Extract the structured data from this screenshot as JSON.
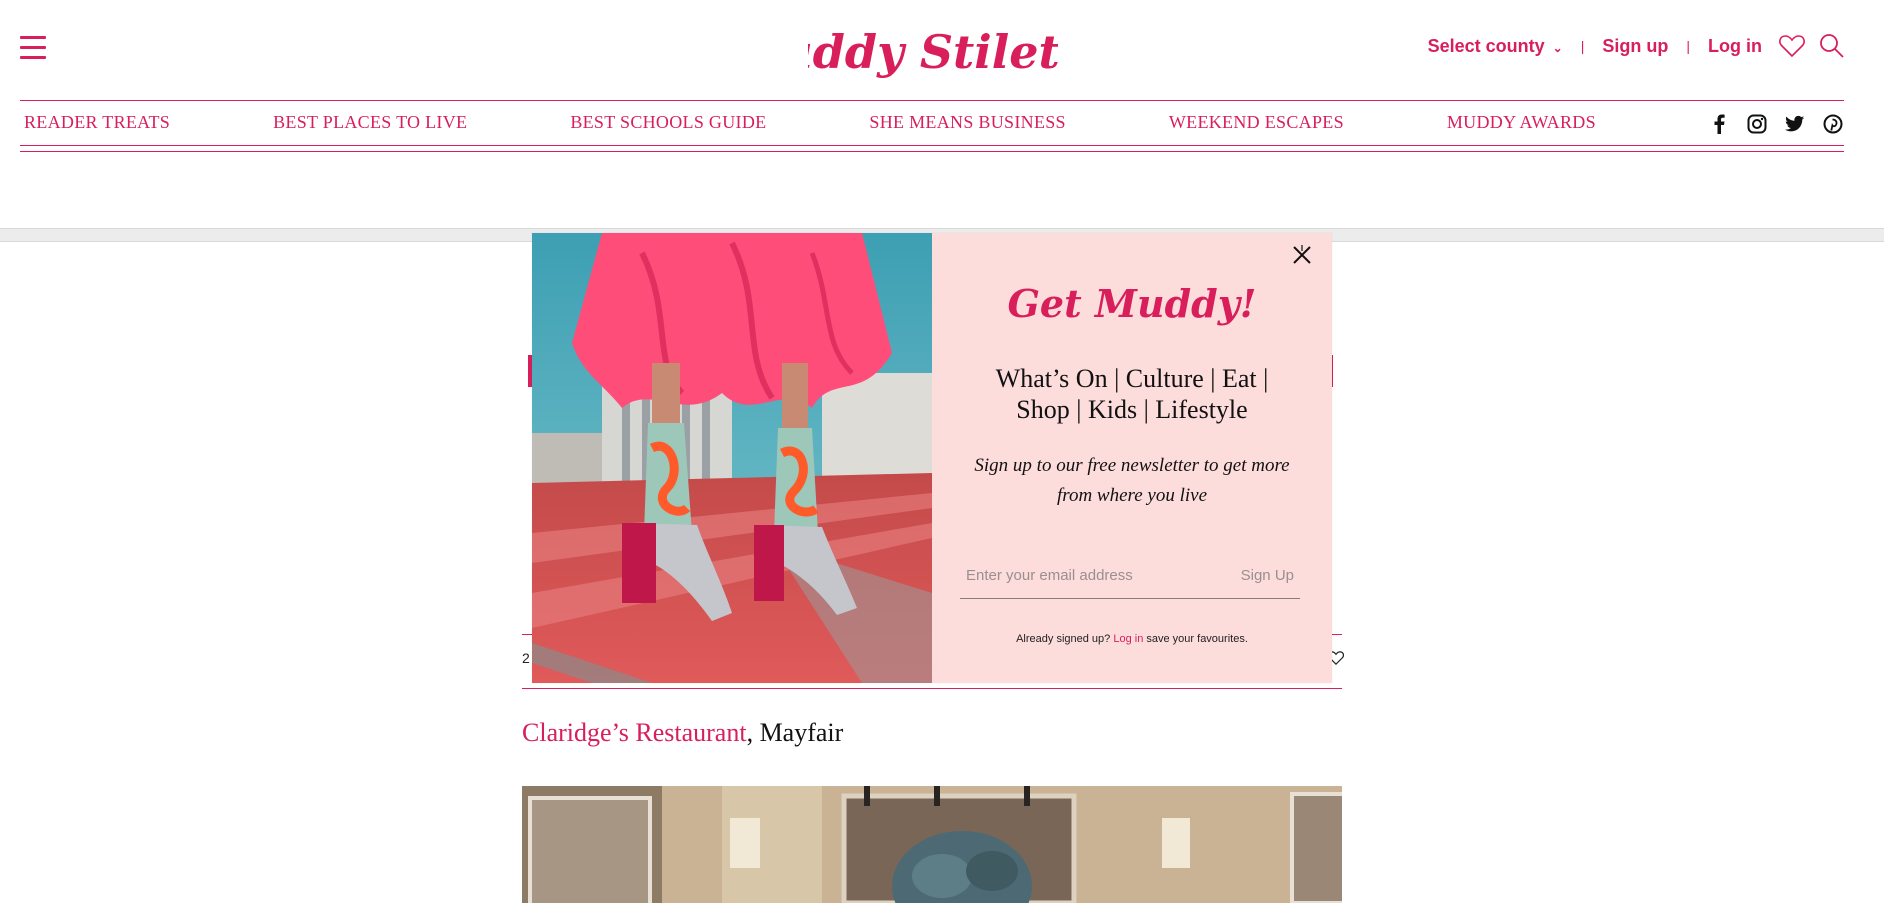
{
  "brand": {
    "logo_text": "Muddy Stilettos",
    "accent": "#d81e5b"
  },
  "header": {
    "county_label": "Select county",
    "signup_label": "Sign up",
    "login_label": "Log in",
    "separator": "|"
  },
  "nav": {
    "items": [
      {
        "label": "READER TREATS"
      },
      {
        "label": "BEST PLACES TO LIVE"
      },
      {
        "label": "BEST SCHOOLS GUIDE"
      },
      {
        "label": "SHE MEANS BUSINESS"
      },
      {
        "label": "WEEKEND ESCAPES"
      },
      {
        "label": "MUDDY AWARDS"
      }
    ],
    "social": [
      "facebook-icon",
      "instagram-icon",
      "twitter-icon",
      "pinterest-icon"
    ]
  },
  "article": {
    "meta_fragment": "2",
    "link_text": "Claridge’s Restaurant",
    "location_text": ", Mayfair"
  },
  "popup": {
    "heading": "Get Muddy!",
    "categories_line1": "What’s On | Culture | Eat |",
    "categories_line2": "Shop | Kids | Lifestyle",
    "blurb": "Sign up to our free newsletter to get more from where you live",
    "email_placeholder": "Enter your email address",
    "signup_button": "Sign Up",
    "already_prefix": "Already signed up?",
    "already_login": "Log in",
    "already_suffix": "save your favourites."
  }
}
